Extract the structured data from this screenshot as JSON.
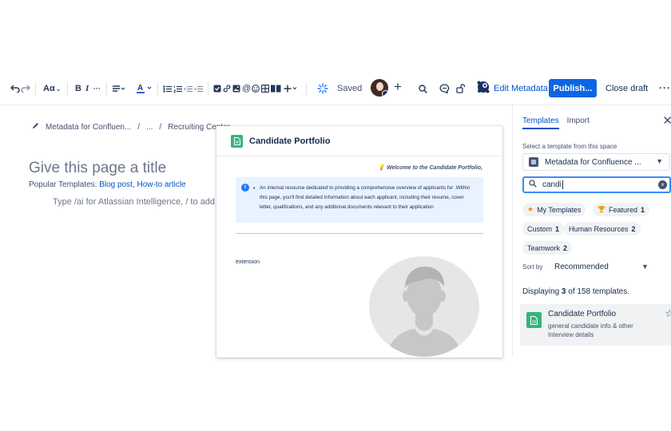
{
  "toolbar": {
    "text_style_label": "Aα",
    "saved_label": "Saved",
    "edit_metadata_label": "Edit Metadata",
    "publish_label": "Publish...",
    "close_draft_label": "Close draft",
    "more_label": "···",
    "icons": [
      "undo-icon",
      "redo-icon",
      "text-style-icon",
      "bold-icon",
      "italic-icon",
      "more-formatting-icon",
      "alignment-icon",
      "text-color-icon",
      "bullet-list-icon",
      "numbered-list-icon",
      "outdent-icon",
      "indent-icon",
      "task-icon",
      "link-icon",
      "image-icon",
      "mention-icon",
      "emoji-icon",
      "table-icon",
      "layout-icon",
      "insert-icon",
      "ai-icon",
      "search-icon",
      "comment-icon",
      "lock-icon",
      "metadata-icon"
    ]
  },
  "editor": {
    "breadcrumb": {
      "item1": "Metadata for Confluen...",
      "sep": "/",
      "item2": "...",
      "item3": "Recruiting Center"
    },
    "title_placeholder": "Give this page a title",
    "popular_label": "Popular Templates:",
    "popular_link1": "Blog post",
    "popular_comma": ",",
    "popular_link2": "How-to article",
    "hint": "Type /ai for Atlassian Intelligence, / to add"
  },
  "preview": {
    "title": "Candidate Portfolio",
    "welcome": "Welcome to the Candidate Portfolio,",
    "info_text": "An internal resource dedicated to providing a comprehensive overview of applicants for .Within this page, you'll find detailed information about each applicant, including their resume, cover letter, qualifications, and any additional documents relevant to their application",
    "extension_label": "extension"
  },
  "panel": {
    "tab_templates": "Templates",
    "tab_import": "Import",
    "select_label": "Select a template from this space",
    "space_value": "Metadata for Confluence ...",
    "search_value": "candi",
    "chips": [
      {
        "label": "My Templates",
        "icon": "star-icon"
      },
      {
        "label": "Featured",
        "count": "1",
        "icon": "trophy-icon"
      },
      {
        "label": "Custom",
        "count": "1"
      },
      {
        "label": "Human Resources",
        "count": "2"
      },
      {
        "label": "Teamwork",
        "count": "2"
      }
    ],
    "sort_label": "Sort by",
    "sort_value": "Recommended",
    "displaying_prefix": "Displaying ",
    "displaying_count": "3",
    "displaying_suffix": " of 158 templates.",
    "result": {
      "title": "Candidate Portfolio",
      "description": "general candidate info & other Interview details"
    }
  },
  "colors": {
    "accent": "#0c66e4",
    "link": "#0052cc",
    "template_green": "#36b37e",
    "info_bg": "#e9f2ff"
  }
}
